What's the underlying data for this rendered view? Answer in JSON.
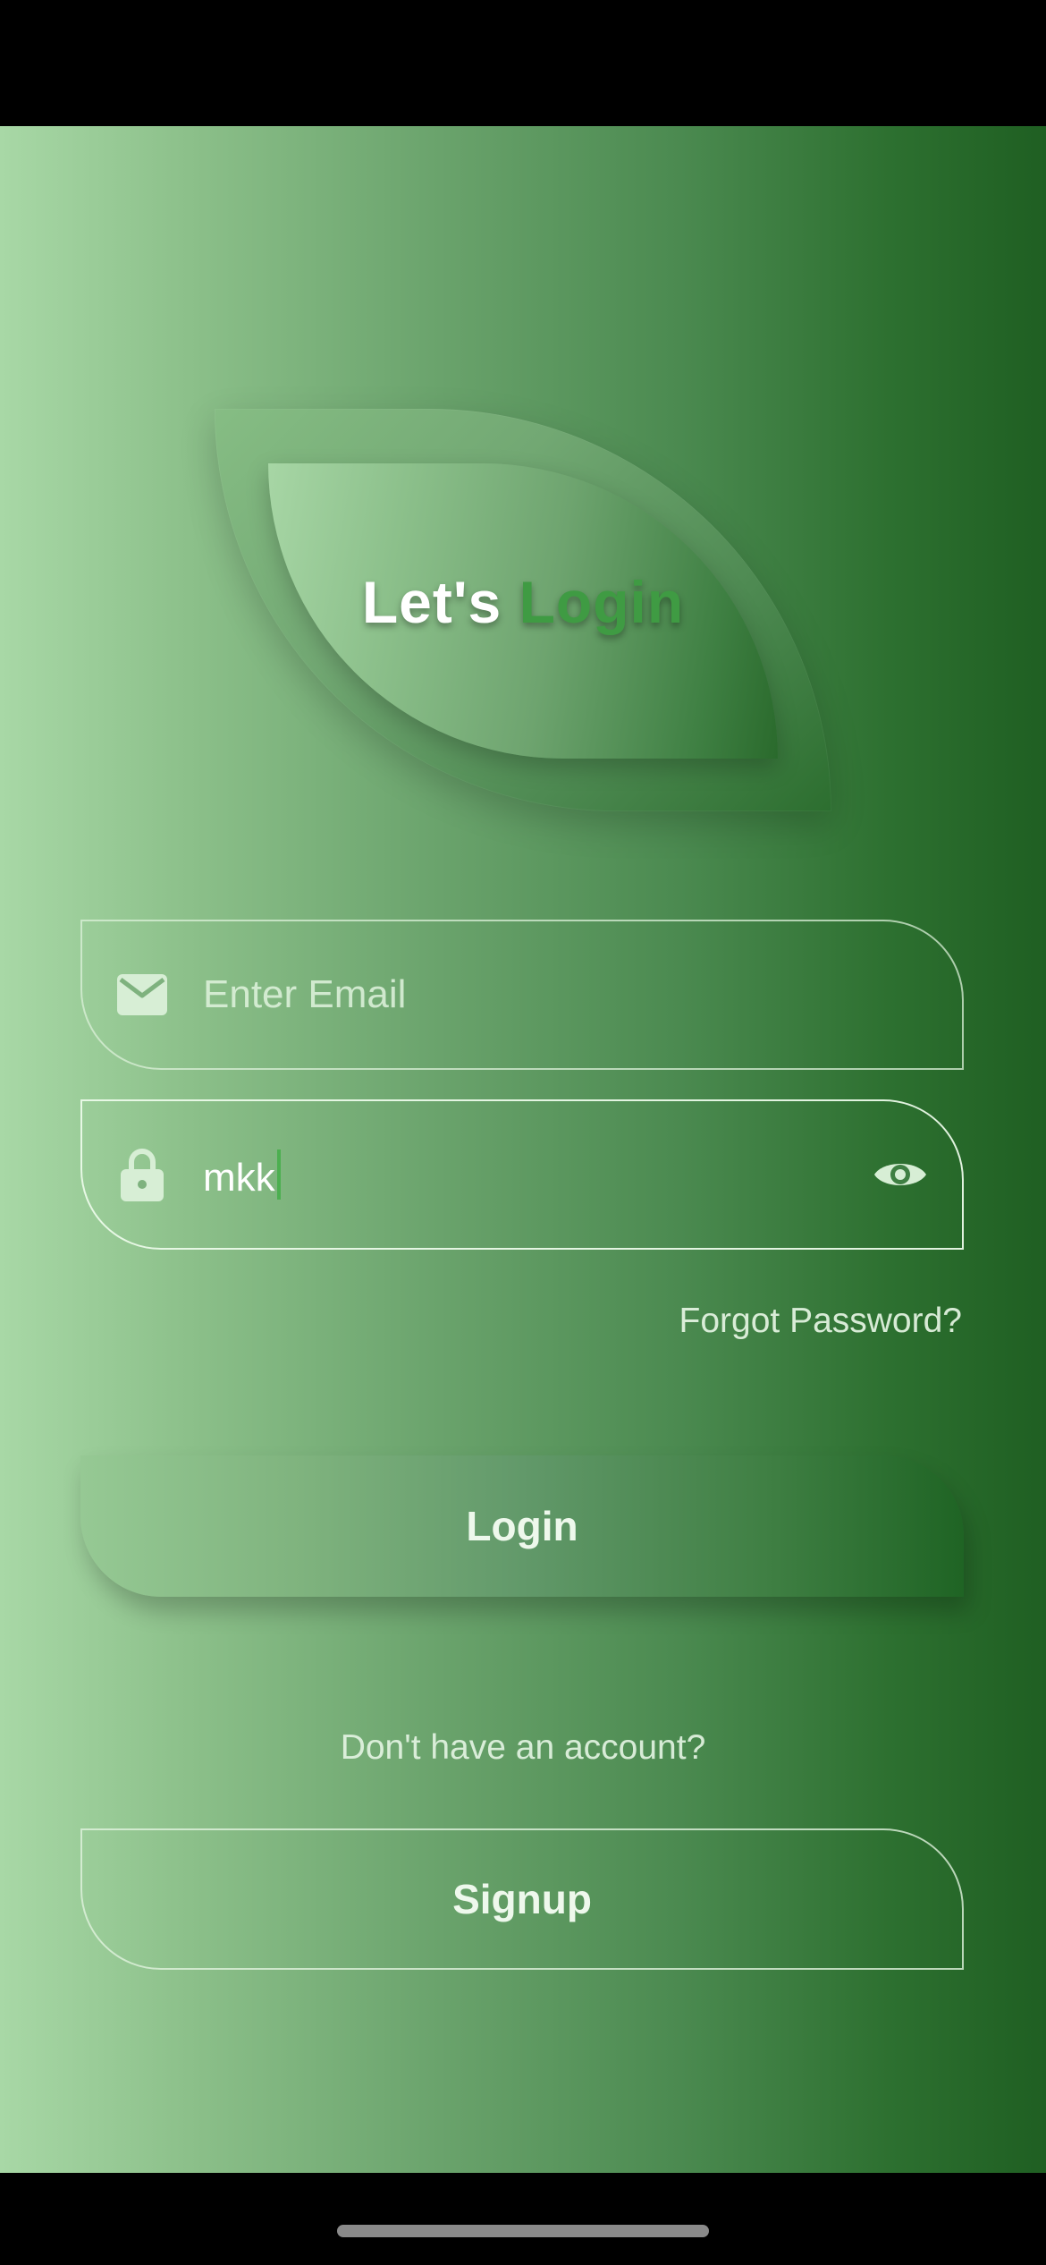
{
  "header": {
    "title_part1": "Let's",
    "title_part2": "Login"
  },
  "email_field": {
    "placeholder": "Enter Email",
    "value": "",
    "icon": "mail-icon"
  },
  "password_field": {
    "value": "mkk",
    "icon": "lock-icon",
    "toggle_icon": "eye-icon"
  },
  "links": {
    "forgot_password": "Forgot Password?"
  },
  "buttons": {
    "login": "Login",
    "signup": "Signup"
  },
  "prompt": {
    "no_account": "Don't have an account?"
  },
  "colors": {
    "accent": "#3f9b43",
    "caret": "#4caf50",
    "gradient_light": "#a8d8a6",
    "gradient_dark": "#1f5f22"
  }
}
